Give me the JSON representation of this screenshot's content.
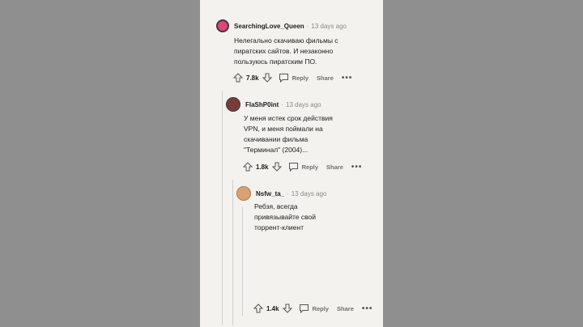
{
  "comments": [
    {
      "username": "SearchingLove_Queen",
      "time": "13 days ago",
      "lines": [
        "Нелегально скачиваю фильмы с",
        "пиратских сайтов. И незаконно",
        "пользуюсь пиратским ПО."
      ],
      "votes": "7.8k",
      "reply_label": "Reply",
      "share_label": "Share",
      "avatar_color": "#e0457b",
      "avatar_icon": "snoo-avatar-icon"
    },
    {
      "username": "FlaShP0int",
      "time": "13 days ago",
      "lines": [
        "У меня истек срок действия",
        "VPN, и меня поймали на",
        "скачивании фильма",
        "\"Терминал\" (2004)..."
      ],
      "votes": "1.8k",
      "reply_label": "Reply",
      "share_label": "Share",
      "avatar_color": "#7b3b3b",
      "avatar_icon": "snoo-avatar-icon"
    },
    {
      "username": "Nsfw_ta_",
      "time": "13 days ago",
      "lines": [
        "Ребзя, всегда",
        "привязывайте свой",
        "торрент-клиент"
      ],
      "votes": "1.4k",
      "reply_label": "Reply",
      "share_label": "Share",
      "avatar_color": "#d9a273",
      "avatar_icon": "snoo-avatar-icon"
    }
  ],
  "separator": "·",
  "more_label": "•••",
  "colors": {
    "background": "#8f8f8f",
    "panel": "#f3f2ef",
    "text": "#1c1c1c",
    "muted": "#8a8a8a"
  }
}
